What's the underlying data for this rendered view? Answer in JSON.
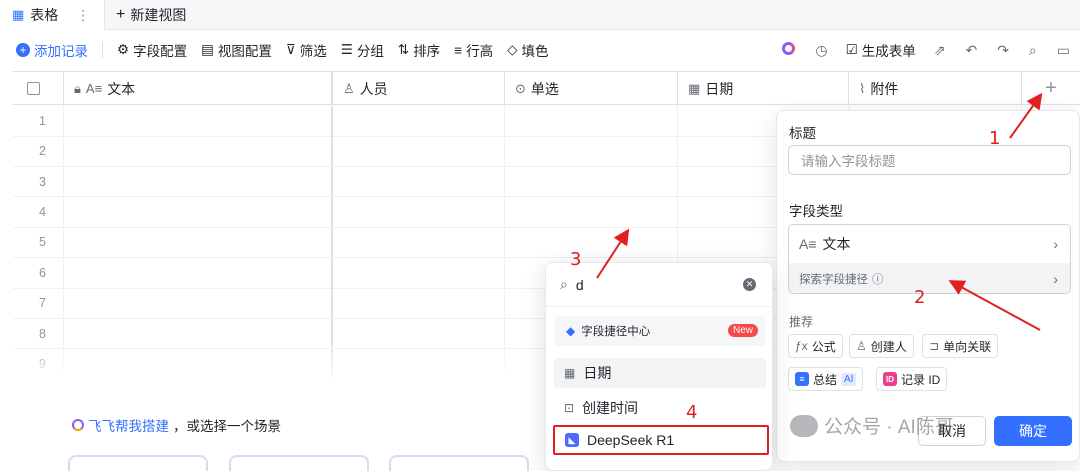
{
  "tabs": {
    "active": "表格",
    "new_view": "新建视图"
  },
  "toolbar": {
    "add_record": "添加记录",
    "field_config": "字段配置",
    "view_config": "视图配置",
    "filter": "筛选",
    "group": "分组",
    "sort": "排序",
    "row_height": "行高",
    "fill": "填色",
    "generate_form": "生成表单"
  },
  "grid": {
    "columns": [
      "文本",
      "人员",
      "单选",
      "日期",
      "附件"
    ],
    "row_numbers": [
      "1",
      "2",
      "3",
      "4",
      "5",
      "6",
      "7",
      "8",
      "9"
    ],
    "add_column_icon": "plus-icon"
  },
  "field_panel": {
    "title_label": "标题",
    "title_placeholder": "请输入字段标题",
    "type_label": "字段类型",
    "type_value": "文本",
    "explore_shortcut": "探索字段捷径",
    "recommend_label": "推荐",
    "chips": [
      "公式",
      "创建人",
      "单向关联",
      "总结",
      "记录 ID"
    ],
    "ai_badge": "AI",
    "cancel": "取消",
    "confirm": "确定"
  },
  "search_dropdown": {
    "query": "d",
    "shortcut_center": "字段捷径中心",
    "new_badge": "New",
    "items": [
      "日期",
      "创建时间",
      "DeepSeek R1"
    ]
  },
  "suggestion": {
    "link": "飞飞帮我搭建",
    "text": "，或选择一个场景"
  },
  "annotations": [
    "1",
    "2",
    "3",
    "4"
  ],
  "watermark": "公众号 · AI陈哥",
  "colors": {
    "accent": "#3370ff",
    "annotation": "#e02020",
    "new_badge": "#f54a45"
  }
}
